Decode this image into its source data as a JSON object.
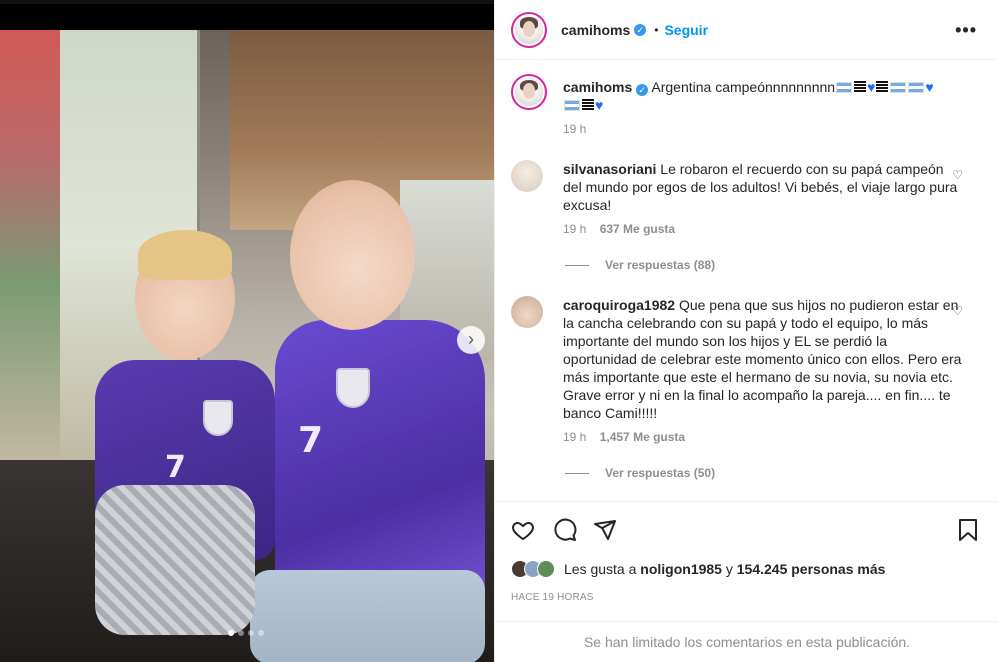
{
  "header": {
    "username": "camihoms",
    "separator": "•",
    "follow_label": "Seguir",
    "more": "•••"
  },
  "caption": {
    "username": "camihoms",
    "text": "Argentina campeónnnnnnnnn",
    "time": "19 h"
  },
  "comments": [
    {
      "username": "silvanasoriani",
      "text": "Le robaron el recuerdo con su papá campeón del mundo por egos de los adultos! Vi bebés, el viaje largo pura excusa!",
      "time": "19 h",
      "likes": "637 Me gusta",
      "replies": "Ver respuestas (88)"
    },
    {
      "username": "caroquiroga1982",
      "text": "Que pena que sus hijos no pudieron estar en la cancha celebrando con su papá y todo el equipo, lo más importante del mundo son los hijos y EL se perdió la oportunidad de celebrar este momento único con ellos. Pero era más importante que este el hermano de su novia, su novia etc. Grave error y ni en la final lo acompaño la pareja.... en fin.... te banco Cami!!!!!",
      "time": "19 h",
      "likes": "1,457 Me gusta",
      "replies": "Ver respuestas (50)"
    }
  ],
  "likes": {
    "prefix": "Les gusta a",
    "user": "noligon1985",
    "conj": "y",
    "count": "154.245 personas más"
  },
  "time_ago": "HACE 19 HORAS",
  "limited_notice": "Se han limitado los comentarios en esta publicación.",
  "icons": {
    "like": "heart-icon",
    "comment": "comment-icon",
    "share": "share-icon",
    "save": "bookmark-icon",
    "next": "chevron-right-icon"
  },
  "colors": {
    "follow": "#0095f6",
    "verified": "#3897f0",
    "jersey": "#5a3bb0"
  },
  "carousel": {
    "total": 4,
    "active": 1
  },
  "jersey_numbers": [
    "7",
    "7"
  ]
}
